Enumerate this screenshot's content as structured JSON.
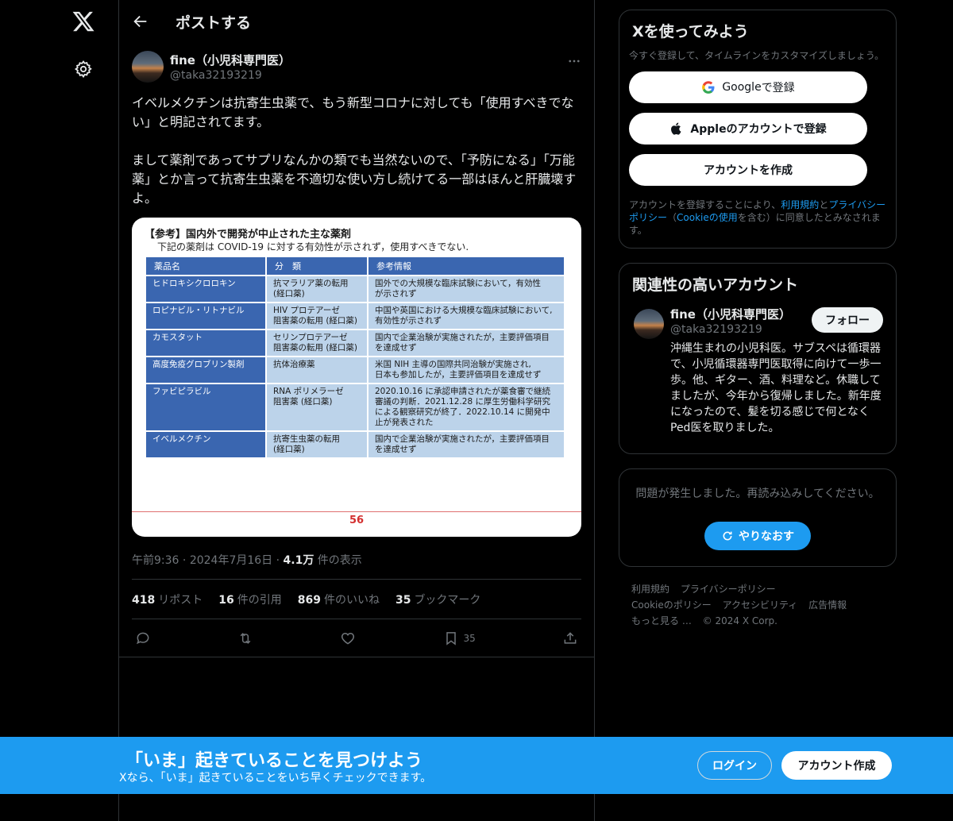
{
  "header": {
    "title": "ポストする"
  },
  "tweet": {
    "author_name": "fine（小児科専門医）",
    "author_handle": "@taka32193219",
    "text": "イベルメクチンは抗寄生虫薬で、もう新型コロナに対しても「使用すべきでない」と明記されてます。\n\nまして薬剤であってサプリなんかの類でも当然ないので、「予防になる」「万能薬」とか言って抗寄生虫薬を不適切な使い方し続けてる一部はほんと肝臓壊すよ。",
    "meta": {
      "time": "午前9:36",
      "date": "2024年7月16日",
      "views_count": "4.1万",
      "views_label": "件の表示"
    },
    "stats": {
      "reposts": "418",
      "reposts_label": "リポスト",
      "quotes": "16",
      "quotes_label": "件の引用",
      "likes": "869",
      "likes_label": "件のいいね",
      "bookmarks": "35",
      "bookmarks_label": "ブックマーク"
    },
    "actions": {
      "bookmark_count": "35"
    }
  },
  "media": {
    "title": "【参考】国内外で開発が中止された主な薬剤",
    "subtitle": "下記の薬剤は COVID-19 に対する有効性が示されず，使用すべきでない.",
    "headers": [
      "薬品名",
      "分　類",
      "参考情報"
    ],
    "rows": [
      [
        "ヒドロキシクロロキン",
        "抗マラリア薬の転用\n(経口薬)",
        "国外での大規模な臨床試験において，有効性\nが示されず"
      ],
      [
        "ロピナビル・リトナビル",
        "HIV プロテアーゼ\n阻害薬の転用 (経口薬)",
        "中国や英国における大規模な臨床試験において,\n有効性が示されず"
      ],
      [
        "カモスタット",
        "セリンプロテアーゼ\n阻害薬の転用 (経口薬)",
        "国内で企業治験が実施されたが，主要評価項目\nを達成せず"
      ],
      [
        "高度免疫グロブリン製剤",
        "抗体治療薬",
        "米国 NIH 主導の国際共同治験が実施され,\n日本も参加したが，主要評価項目を達成せず"
      ],
      [
        "ファビピラビル",
        "RNA ポリメラーゼ\n阻害薬 (経口薬)",
        "2020.10.16 に承認申請されたが薬食審で継続\n審議の判断．2021.12.28 に厚生労働科学研究\nによる観察研究が終了．2022.10.14 に開発中\n止が発表された"
      ],
      [
        "イベルメクチン",
        "抗寄生虫薬の転用\n(経口薬)",
        "国内で企業治験が実施されたが，主要評価項目\nを達成せず"
      ]
    ],
    "page_number": "56"
  },
  "signup_card": {
    "title": "Xを使ってみよう",
    "subtitle": "今すぐ登録して、タイムラインをカスタマイズしましょう。",
    "google_brand": "Google",
    "google_suffix": " で登録",
    "apple_label": "Appleのアカウントで登録",
    "create_label": "アカウントを作成",
    "legal_1": "アカウントを登録することにより、",
    "legal_terms": "利用規約",
    "legal_and": "と",
    "legal_privacy": "プライバシーポリシー",
    "legal_2": "（",
    "legal_cookie": "Cookieの使用",
    "legal_3": "を含む）に同意したとみなされます。"
  },
  "related": {
    "title": "関連性の高いアカウント",
    "name": "fine（小児科専門医）",
    "handle": "@taka32193219",
    "follow_label": "フォロー",
    "bio": "沖縄生まれの小児科医。サブスペは循環器で、小児循環器専門医取得に向けて一歩一歩。他、ギター、酒、料理など。休職してましたが、今年から復帰しました。新年度になったので、髪を切る感じで何となくPed医を取りました。"
  },
  "error_card": {
    "message": "問題が発生しました。再読み込みしてください。",
    "retry_label": "やりなおす"
  },
  "footer": {
    "links": [
      "利用規約",
      "プライバシーポリシー",
      "Cookieのポリシー",
      "アクセシビリティ",
      "広告情報",
      "もっと見る …"
    ],
    "copyright": "© 2024 X Corp."
  },
  "banner": {
    "title": "「いま」起きていることを見つけよう",
    "subtitle": "Xなら、「いま」起きていることをいち早くチェックできます。",
    "login_label": "ログイン",
    "signup_label": "アカウント作成"
  },
  "colors": {
    "accent": "#1d9bf0",
    "background": "#000000",
    "border": "#2f3336",
    "muted": "#71767b"
  },
  "icons": [
    "x-logo-icon",
    "gear-icon",
    "back-arrow-icon",
    "more-icon",
    "reply-icon",
    "repost-icon",
    "like-icon",
    "bookmark-icon",
    "share-icon",
    "google-icon",
    "apple-icon",
    "refresh-icon"
  ]
}
